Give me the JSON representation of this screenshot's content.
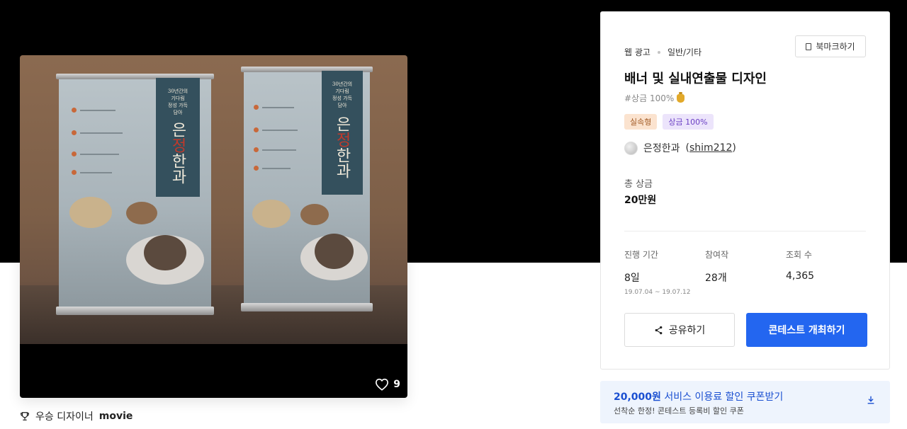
{
  "gallery": {
    "likes": "9",
    "winner_label": "우승 디자이너",
    "winner_name": "movie",
    "banner_small_text": [
      "30년간의",
      "기다림",
      "정성 가득",
      "담아"
    ],
    "banner_title_parts": [
      "은",
      "정",
      "한과"
    ]
  },
  "contest": {
    "category_main": "웹 광고",
    "category_sub": "일반/기타",
    "bookmark_label": "북마크하기",
    "title": "배너 및 실내연출물 디자인",
    "hashtag": "#상금 100%",
    "tags": [
      "실속형",
      "상금 100%"
    ],
    "host_name": "은정한과",
    "host_id": "shim212",
    "prize_label": "총 상금",
    "prize_value": "20만원",
    "stats": {
      "period_label": "진행 기간",
      "period_value": "8일",
      "period_range": "19.07.04 ~ 19.07.12",
      "entries_label": "참여작",
      "entries_value": "28개",
      "views_label": "조회 수",
      "views_value": "4,365"
    },
    "share_label": "공유하기",
    "host_contest_label": "콘테스트 개최하기"
  },
  "coupon": {
    "amount": "20,000원",
    "title_rest": " 서비스 이용료 할인 쿠폰받기",
    "subtitle": "선착순 한정! 콘테스트 등록비 할인 쿠폰"
  },
  "colors": {
    "accent": "#2366f0",
    "coupon_bg": "#eef4fd",
    "tag_orange_bg": "#fbe3cf",
    "tag_purple_bg": "#ece4fb"
  }
}
